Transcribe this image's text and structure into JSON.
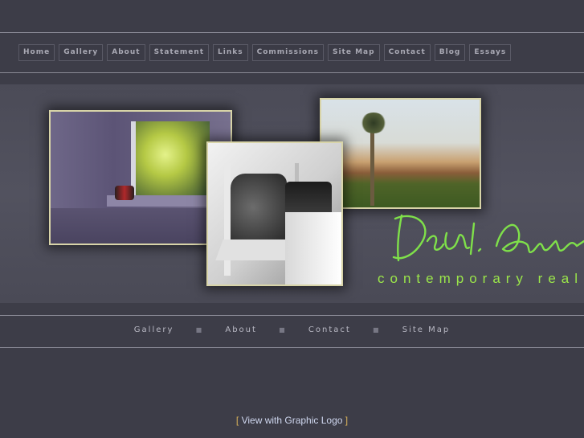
{
  "top_nav": {
    "items": [
      {
        "label": "Home"
      },
      {
        "label": "Gallery"
      },
      {
        "label": "About"
      },
      {
        "label": "Statement"
      },
      {
        "label": "Links"
      },
      {
        "label": "Commissions"
      },
      {
        "label": "Site Map"
      },
      {
        "label": "Contact"
      },
      {
        "label": "Blog"
      },
      {
        "label": "Essays"
      }
    ]
  },
  "hero": {
    "signature_text": "Desal. Ames",
    "tagline": "contemporary realism"
  },
  "mid_nav": {
    "items": [
      {
        "label": "Gallery"
      },
      {
        "label": "About"
      },
      {
        "label": "Contact"
      },
      {
        "label": "Site Map"
      }
    ],
    "separator": "■"
  },
  "footer": {
    "open_bracket": "[",
    "link_label": "View with Graphic Logo",
    "close_bracket": "]"
  },
  "colors": {
    "background": "#3d3d48",
    "accent_green": "#9be64a",
    "link_blue": "#cfd7ef",
    "bracket_gold": "#d9b25a"
  }
}
